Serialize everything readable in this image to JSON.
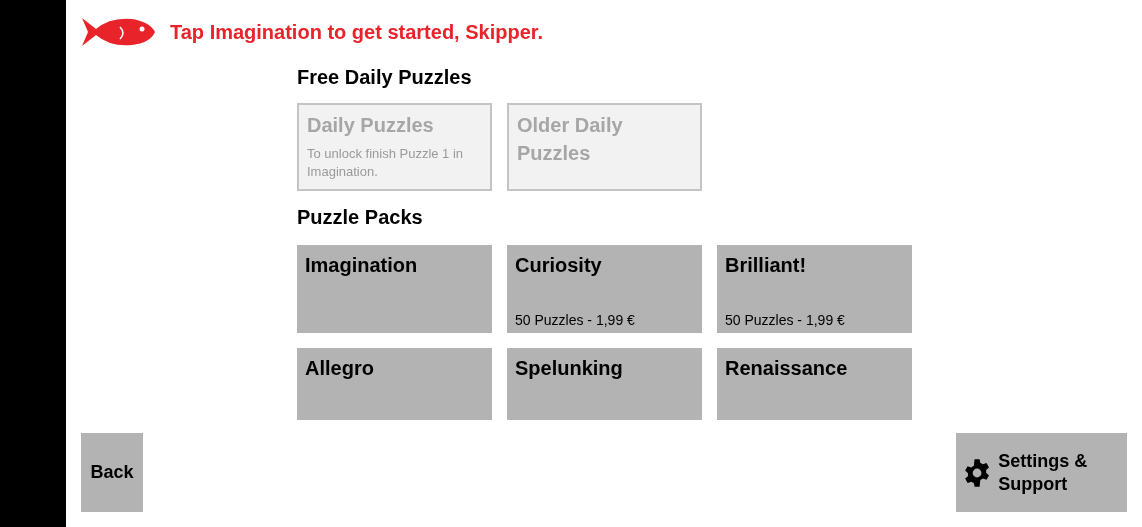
{
  "header": {
    "message": "Tap Imagination to get started, Skipper."
  },
  "daily": {
    "title": "Free Daily Puzzles",
    "items": [
      {
        "title": "Daily Puzzles",
        "note": "To unlock finish Puzzle 1 in Imagination.",
        "disabled": true
      },
      {
        "title": "Older Daily Puzzles",
        "disabled": true
      }
    ]
  },
  "packs": {
    "title": "Puzzle Packs",
    "items": [
      {
        "title": "Imagination"
      },
      {
        "title": "Curiosity",
        "price": "50 Puzzles - 1,99 €"
      },
      {
        "title": "Brilliant!",
        "price": "50 Puzzles - 1,99 €"
      },
      {
        "title": "Allegro"
      },
      {
        "title": "Spelunking"
      },
      {
        "title": "Renaissance"
      }
    ]
  },
  "back_button": "Back",
  "settings_button": "Settings & Support"
}
